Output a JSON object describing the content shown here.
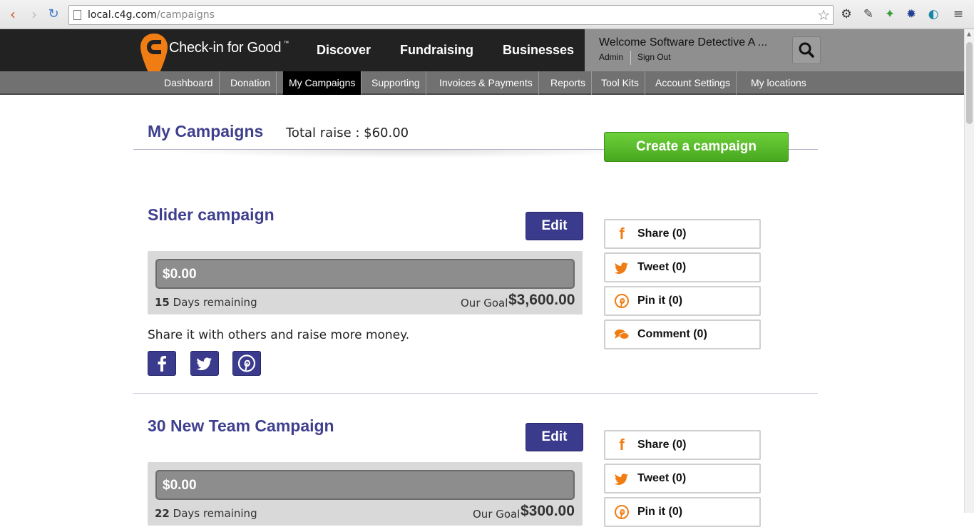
{
  "browser": {
    "url_host": "local.c4g.com",
    "url_path": "/campaigns"
  },
  "site": {
    "brand": "Check-in for Good",
    "brand_tm": "™",
    "main_nav": [
      "Discover",
      "Fundraising",
      "Businesses"
    ],
    "welcome": "Welcome Software Detective A ...",
    "admin_link": "Admin",
    "signout_link": "Sign Out"
  },
  "subnav": {
    "items": [
      "Dashboard",
      "Donation",
      "My Campaigns",
      "Supporting",
      "Invoices & Payments",
      "Reports",
      "Tool Kits",
      "Account Settings",
      "My locations"
    ],
    "active": "My Campaigns"
  },
  "page": {
    "title": "My Campaigns",
    "total_raise": "Total raise : $60.00",
    "create_button": "Create a campaign"
  },
  "campaigns": [
    {
      "title": "Slider campaign",
      "edit": "Edit",
      "raised": "$0.00",
      "progress_fraction": 0,
      "days_number": "15",
      "days_text": " Days remaining",
      "goal_label": "Our Goal",
      "goal_value": "$3,600.00",
      "share_text": "Share it with others and raise more money.",
      "actions": [
        "Share (0)",
        "Tweet (0)",
        "Pin it (0)",
        "Comment (0)"
      ]
    },
    {
      "title": "30 New Team Campaign",
      "edit": "Edit",
      "raised": "$0.00",
      "progress_fraction": 0,
      "days_number": "22",
      "days_text": " Days remaining",
      "goal_label": "Our Goal",
      "goal_value": "$300.00",
      "actions": [
        "Share (0)",
        "Tweet (0)",
        "Pin it (0)"
      ]
    }
  ],
  "colors": {
    "brand_orange": "#f07d14",
    "header_dark": "#222222",
    "title_blue": "#3f3f8f",
    "button_blue": "#3b3b8d",
    "create_green": "#5bbf2c"
  }
}
